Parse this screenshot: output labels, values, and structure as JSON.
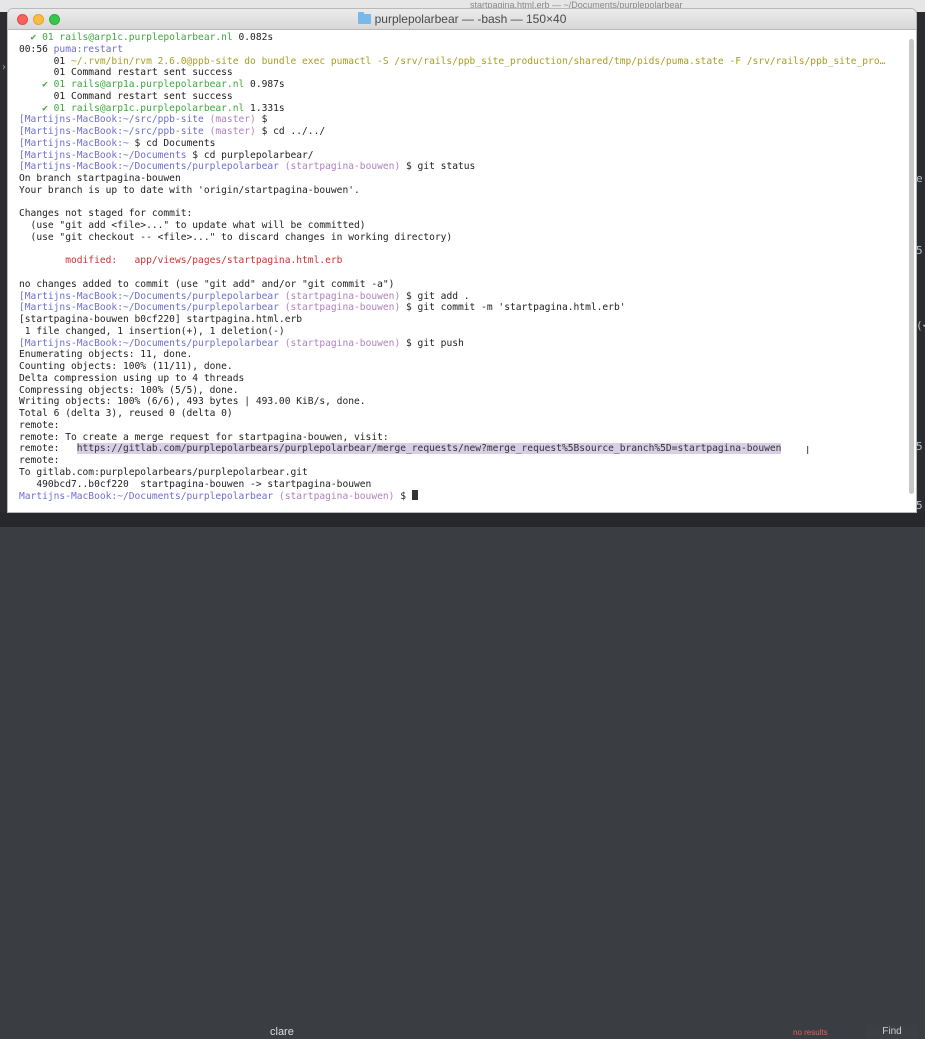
{
  "background": {
    "editor_title": "startpagina.html.erb — ~/Documents/purplepolarbear",
    "right_fragments": [
      "e'",
      "5'",
      "(<",
      "5'",
      "5'"
    ],
    "find": {
      "query": "clare",
      "status": "no results",
      "button": "Find"
    }
  },
  "terminal": {
    "title": "purplepolarbear — -bash — 150×40",
    "lines": [
      [
        {
          "t": "  ✔ 01 rails@arp1c.purplepolarbear.nl",
          "c": "green"
        },
        {
          "t": " 0.082s",
          "c": "plain"
        }
      ],
      [
        {
          "t": "00:56 ",
          "c": "plain"
        },
        {
          "t": "puma:restart",
          "c": "prompt"
        }
      ],
      [
        {
          "t": "      01 ",
          "c": "plain"
        },
        {
          "t": "~/.rvm/bin/rvm 2.6.0@ppb-site do bundle exec pumactl -S /srv/rails/ppb_site_production/shared/tmp/pids/puma.state -F /srv/rails/ppb_site_pro…",
          "c": "yellow"
        }
      ],
      [
        {
          "t": "      01 Command restart sent success",
          "c": "plain"
        }
      ],
      [
        {
          "t": "    ✔ 01 rails@arp1a.purplepolarbear.nl",
          "c": "green"
        },
        {
          "t": " 0.987s",
          "c": "plain"
        }
      ],
      [
        {
          "t": "      01 Command restart sent success",
          "c": "plain"
        }
      ],
      [
        {
          "t": "    ✔ 01 rails@arp1c.purplepolarbear.nl",
          "c": "green"
        },
        {
          "t": " 1.331s",
          "c": "plain"
        }
      ],
      [
        {
          "t": "[Martijns-MacBook:~/src/ppb-site ",
          "c": "prompt"
        },
        {
          "t": "(master)",
          "c": "branch"
        },
        {
          "t": " $",
          "c": "plain"
        }
      ],
      [
        {
          "t": "[Martijns-MacBook:~/src/ppb-site ",
          "c": "prompt"
        },
        {
          "t": "(master)",
          "c": "branch"
        },
        {
          "t": " $ cd ../../",
          "c": "plain"
        }
      ],
      [
        {
          "t": "[Martijns-MacBook:~",
          "c": "prompt"
        },
        {
          "t": " $ cd Documents",
          "c": "plain"
        }
      ],
      [
        {
          "t": "[Martijns-MacBook:~/Documents",
          "c": "prompt"
        },
        {
          "t": " $ cd purplepolarbear/",
          "c": "plain"
        }
      ],
      [
        {
          "t": "[Martijns-MacBook:~/Documents/purplepolarbear ",
          "c": "prompt"
        },
        {
          "t": "(startpagina-bouwen)",
          "c": "branch"
        },
        {
          "t": " $ git status",
          "c": "plain"
        }
      ],
      [
        {
          "t": "On branch startpagina-bouwen",
          "c": "plain"
        }
      ],
      [
        {
          "t": "Your branch is up to date with 'origin/startpagina-bouwen'.",
          "c": "plain"
        }
      ],
      [
        {
          "t": "",
          "c": "plain"
        }
      ],
      [
        {
          "t": "Changes not staged for commit:",
          "c": "plain"
        }
      ],
      [
        {
          "t": "  (use \"git add <file>...\" to update what will be committed)",
          "c": "plain"
        }
      ],
      [
        {
          "t": "  (use \"git checkout -- <file>...\" to discard changes in working directory)",
          "c": "plain"
        }
      ],
      [
        {
          "t": "",
          "c": "plain"
        }
      ],
      [
        {
          "t": "        modified:   app/views/pages/startpagina.html.erb",
          "c": "red"
        }
      ],
      [
        {
          "t": "",
          "c": "plain"
        }
      ],
      [
        {
          "t": "no changes added to commit (use \"git add\" and/or \"git commit -a\")",
          "c": "plain"
        }
      ],
      [
        {
          "t": "[Martijns-MacBook:~/Documents/purplepolarbear ",
          "c": "prompt"
        },
        {
          "t": "(startpagina-bouwen)",
          "c": "branch"
        },
        {
          "t": " $ git add .",
          "c": "plain"
        }
      ],
      [
        {
          "t": "[Martijns-MacBook:~/Documents/purplepolarbear ",
          "c": "prompt"
        },
        {
          "t": "(startpagina-bouwen)",
          "c": "branch"
        },
        {
          "t": " $ git commit -m 'startpagina.html.erb'",
          "c": "plain"
        }
      ],
      [
        {
          "t": "[startpagina-bouwen b0cf220] startpagina.html.erb",
          "c": "plain"
        }
      ],
      [
        {
          "t": " 1 file changed, 1 insertion(+), 1 deletion(-)",
          "c": "plain"
        }
      ],
      [
        {
          "t": "[Martijns-MacBook:~/Documents/purplepolarbear ",
          "c": "prompt"
        },
        {
          "t": "(startpagina-bouwen)",
          "c": "branch"
        },
        {
          "t": " $ git push",
          "c": "plain"
        }
      ],
      [
        {
          "t": "Enumerating objects: 11, done.",
          "c": "plain"
        }
      ],
      [
        {
          "t": "Counting objects: 100% (11/11), done.",
          "c": "plain"
        }
      ],
      [
        {
          "t": "Delta compression using up to 4 threads",
          "c": "plain"
        }
      ],
      [
        {
          "t": "Compressing objects: 100% (5/5), done.",
          "c": "plain"
        }
      ],
      [
        {
          "t": "Writing objects: 100% (6/6), 493 bytes | 493.00 KiB/s, done.",
          "c": "plain"
        }
      ],
      [
        {
          "t": "Total 6 (delta 3), reused 0 (delta 0)",
          "c": "plain"
        }
      ],
      [
        {
          "t": "remote:",
          "c": "plain"
        }
      ],
      [
        {
          "t": "remote: To create a merge request for startpagina-bouwen, visit:",
          "c": "plain"
        }
      ],
      [
        {
          "t": "remote:   ",
          "c": "plain"
        },
        {
          "t": "https://gitlab.com/purplepolarbears/purplepolarbear/merge_requests/new?merge_request%5Bsource_branch%5D=startpagina-bouwen",
          "c": "url"
        }
      ],
      [
        {
          "t": "remote:",
          "c": "plain"
        }
      ],
      [
        {
          "t": "To gitlab.com:purplepolarbears/purplepolarbear.git",
          "c": "plain"
        }
      ],
      [
        {
          "t": "   490bcd7..b0cf220  startpagina-bouwen -> startpagina-bouwen",
          "c": "plain"
        }
      ],
      [
        {
          "t": "Martijns-MacBook:~/Documents/purplepolarbear ",
          "c": "prompt"
        },
        {
          "t": "(startpagina-bouwen)",
          "c": "branch"
        },
        {
          "t": " $ ",
          "c": "plain"
        },
        {
          "t": "",
          "c": "cursor"
        }
      ]
    ]
  },
  "colors": {
    "prompt": "#6f6fd0",
    "branch": "#b080c0",
    "success": "#3da83d",
    "modified": "#cc3333",
    "command": "#a8a020"
  }
}
